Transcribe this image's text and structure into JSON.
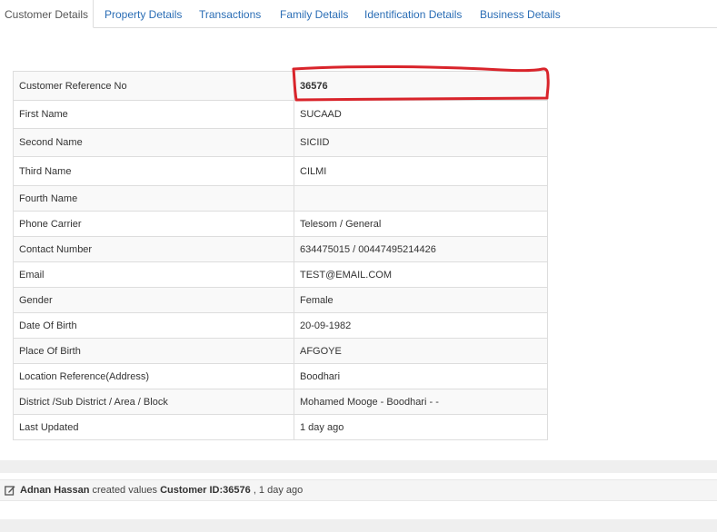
{
  "tabs": [
    {
      "label": "Customer Details"
    },
    {
      "label": "Property Details"
    },
    {
      "label": "Transactions"
    },
    {
      "label": "Family Details"
    },
    {
      "label": "Identification Details"
    },
    {
      "label": "Business Details"
    }
  ],
  "details": [
    {
      "label": "Customer Reference No",
      "value": "36576"
    },
    {
      "label": "First Name",
      "value": "SUCAAD"
    },
    {
      "label": "Second Name",
      "value": "SICIID"
    },
    {
      "label": "Third Name",
      "value": "CILMI"
    },
    {
      "label": "Fourth Name",
      "value": ""
    },
    {
      "label": "Phone Carrier",
      "value": "Telesom / General"
    },
    {
      "label": "Contact Number",
      "value": "634475015 / 00447495214426"
    },
    {
      "label": "Email",
      "value": "TEST@EMAIL.COM"
    },
    {
      "label": "Gender",
      "value": "Female"
    },
    {
      "label": "Date Of Birth",
      "value": "20-09-1982"
    },
    {
      "label": "Place Of Birth",
      "value": "AFGOYE"
    },
    {
      "label": "Location Reference(Address)",
      "value": "Boodhari"
    },
    {
      "label": "District /Sub District / Area / Block",
      "value": "Mohamed Mooge - Boodhari - -"
    },
    {
      "label": "Last Updated",
      "value": "1 day ago"
    }
  ],
  "activity": {
    "user": "Adnan Hassan",
    "action": "created values",
    "target": "Customer ID:36576",
    "time": ", 1 day ago",
    "icon": "edit-icon"
  },
  "colors": {
    "tab_link": "#2a6db5",
    "highlight": "#d9242b"
  }
}
